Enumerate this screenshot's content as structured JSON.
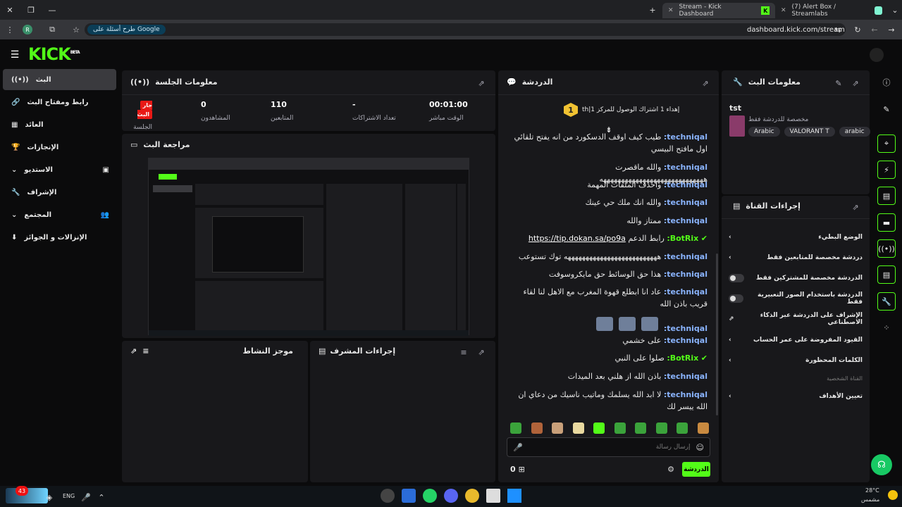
{
  "browser": {
    "tabs": [
      {
        "label": "Stream - Kick Dashboard"
      },
      {
        "label": "(7) Alert Box / Streamlabs"
      }
    ],
    "search_pill": "طرح أسئلة على Google",
    "url": "dashboard.kick.com/stream",
    "profile_initial": "R"
  },
  "brand": {
    "logo": "KICK",
    "beta": "BETA"
  },
  "sidebar": {
    "items": [
      {
        "label": "البث"
      },
      {
        "label": "رابط ومفتاح البث"
      },
      {
        "label": "العائد"
      },
      {
        "label": "الإنجازات"
      },
      {
        "label": "الاستديو"
      },
      {
        "label": "الإشراف"
      },
      {
        "label": "المجتمع"
      },
      {
        "label": "الإنزالات و الجوائز"
      }
    ]
  },
  "session": {
    "title": "معلومات الجلسة",
    "live_badge": "جار البث",
    "stats": [
      {
        "label": "الجلسة",
        "value": ""
      },
      {
        "label": "المشاهدون",
        "value": "0"
      },
      {
        "label": "المتابعين",
        "value": "110"
      },
      {
        "label": "تعداد الاشتراكات",
        "value": "-"
      },
      {
        "label": "الوقت مباشر",
        "value": "00:01:00"
      }
    ]
  },
  "review": {
    "title": "مراجعة البث"
  },
  "activity": {
    "title": "موجز النشاط"
  },
  "mod_actions": {
    "title": "إجراءات المشرف"
  },
  "chat": {
    "title": "الدردشة",
    "pinned_rank": "1",
    "pinned_text": "th|إهداء 1 اشتراك الوصول للمركز 1",
    "messages": [
      {
        "user": "techniqal:",
        "text": "طيب كيف اوقف الدسكورد من انه يفتح تلقائي اول مافتح البيسي"
      },
      {
        "user": "techniqal:",
        "text": "والله ماقصرت هههههههههههههههههههههههههههههه"
      },
      {
        "user": "techniqal:",
        "text": "واحذف الملفات المهمة"
      },
      {
        "user": "techniqal:",
        "text": "والله انك ملك حي عينك"
      },
      {
        "user": "techniqal:",
        "text": "ممتاز والله"
      },
      {
        "user": "BotRix:",
        "text": "رابط الدعم",
        "link": "https://tip.dokan.sa/po9a"
      },
      {
        "user": "techniqal:",
        "text": "ههههههههههههههههههههههههههه توك تستوعب"
      },
      {
        "user": "techniqal:",
        "text": "هذا حق الوسائط حق مايكروسوفت"
      },
      {
        "user": "techniqal:",
        "text": "عاد انا ابطلع قهوة المغرب مع الاهل لنا لقاء قريب باذن الله"
      },
      {
        "user": "techniqal:",
        "text": ""
      },
      {
        "user": "techniqal:",
        "text": "على خشمي"
      },
      {
        "user": "BotRix:",
        "text": "صلوا على النبي"
      },
      {
        "user": "techniqal:",
        "text": "باذن الله از هلني بعد الميدات"
      },
      {
        "user": "techniqal:",
        "text": "لا ابد الله يسلمك وماتيب ناسيك من دعاي ان الله ييسر لك"
      }
    ],
    "input_placeholder": "إرسال رسالة",
    "send_label": "الدردشة",
    "points": "0"
  },
  "stream_info": {
    "title": "معلومات البث",
    "stream_title": "tst",
    "category_note": "مخصصة للدردشة فقط",
    "tags": [
      "Arabic",
      "VALORANT T",
      "arabic"
    ]
  },
  "channel_actions": {
    "title": "إجراءات القناة",
    "items": [
      {
        "label": "الوضع البطيء",
        "control": "chevron"
      },
      {
        "label": "دردشة مخصصة للمتابعين فقط",
        "control": "chevron"
      },
      {
        "label": "الدردشة مخصصة للمشتركين فقط",
        "control": "toggle"
      },
      {
        "label": "الدردشة باستخدام الصور التعبيرية فقط",
        "control": "toggle"
      },
      {
        "label": "الإشراف على الدردشة عبر الذكاء الاصطناعي",
        "control": "external"
      },
      {
        "label": "القيود المفروضة على عمر الحساب",
        "control": "chevron"
      },
      {
        "label": "الكلمات المحظورة",
        "control": "chevron"
      }
    ],
    "section_label": "القناة الشخصية",
    "goals": "تعيين الأهداف"
  },
  "taskbar": {
    "lang": "ENG",
    "weather_temp": "28°C",
    "weather_text": "مشمس",
    "badge": "43"
  },
  "colors": {
    "accent": "#53fc18",
    "live": "#e91916",
    "panel": "#18181b"
  }
}
